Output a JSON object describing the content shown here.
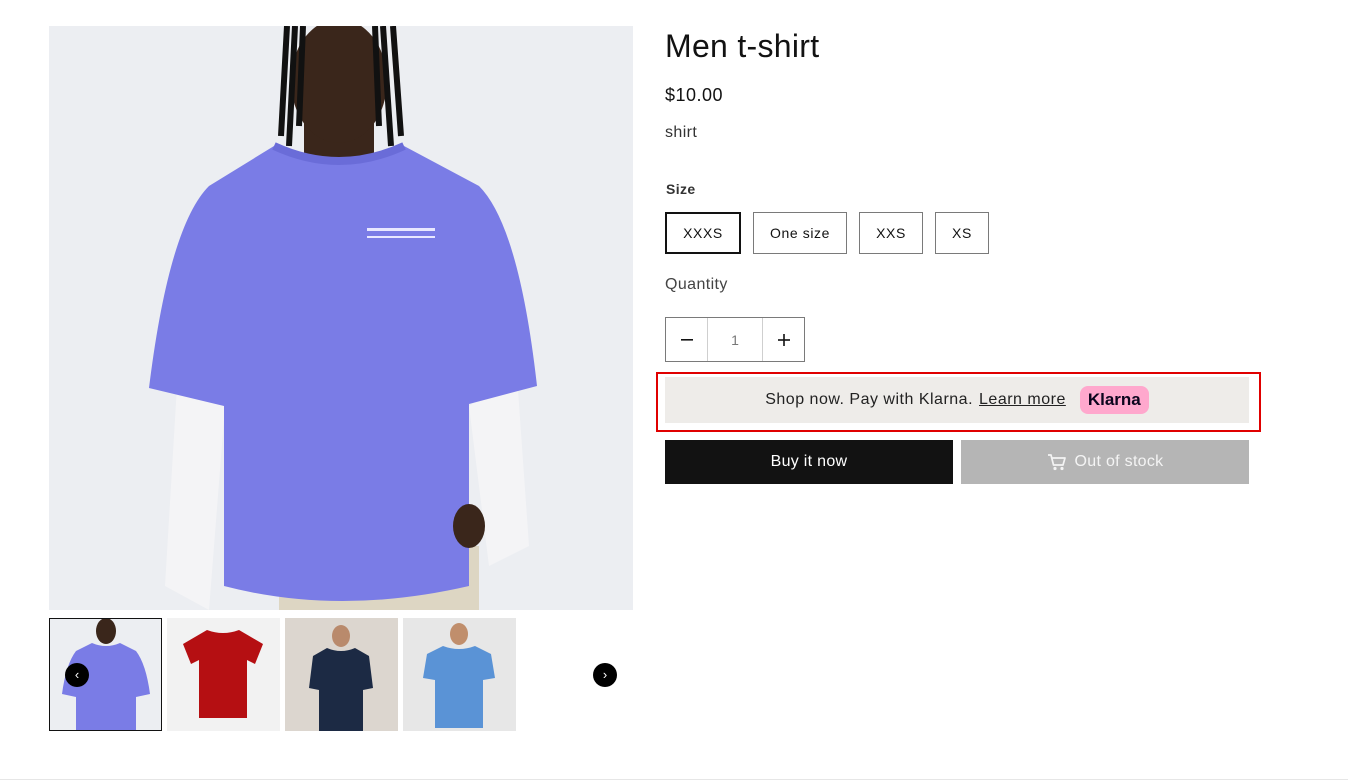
{
  "product": {
    "title": "Men t-shirt",
    "price": "$10.00",
    "description": "shirt"
  },
  "gallery": {
    "main_image": "purple-oversized-tshirt-photo",
    "thumbnails": [
      {
        "name": "thumbnail-purple-tshirt",
        "color": "#7a7ce6",
        "selected": true
      },
      {
        "name": "thumbnail-red-tshirt",
        "color": "#b50f12",
        "selected": false
      },
      {
        "name": "thumbnail-navy-tshirt",
        "color": "#1c2a44",
        "selected": false
      },
      {
        "name": "thumbnail-blue-tshirt",
        "color": "#5a93d6",
        "selected": false
      }
    ],
    "prev_icon": "‹",
    "next_icon": "›"
  },
  "size": {
    "label": "Size",
    "options": [
      "XXXS",
      "One size",
      "XXS",
      "XS"
    ],
    "selected": "XXXS"
  },
  "quantity": {
    "label": "Quantity",
    "value": "1",
    "decrease_icon": "minus-icon",
    "increase_icon": "plus-icon"
  },
  "klarna": {
    "message": "Shop now. Pay with Klarna.",
    "link": "Learn more",
    "badge": "Klarna"
  },
  "actions": {
    "buy_now": "Buy it now",
    "out_of_stock": "Out of stock",
    "cart_icon": "cart-icon"
  },
  "colors": {
    "accent": "#121212",
    "disabled": "#b5b5b5",
    "highlight_outline": "#e00000",
    "klarna_pink": "#ffa8cd"
  }
}
